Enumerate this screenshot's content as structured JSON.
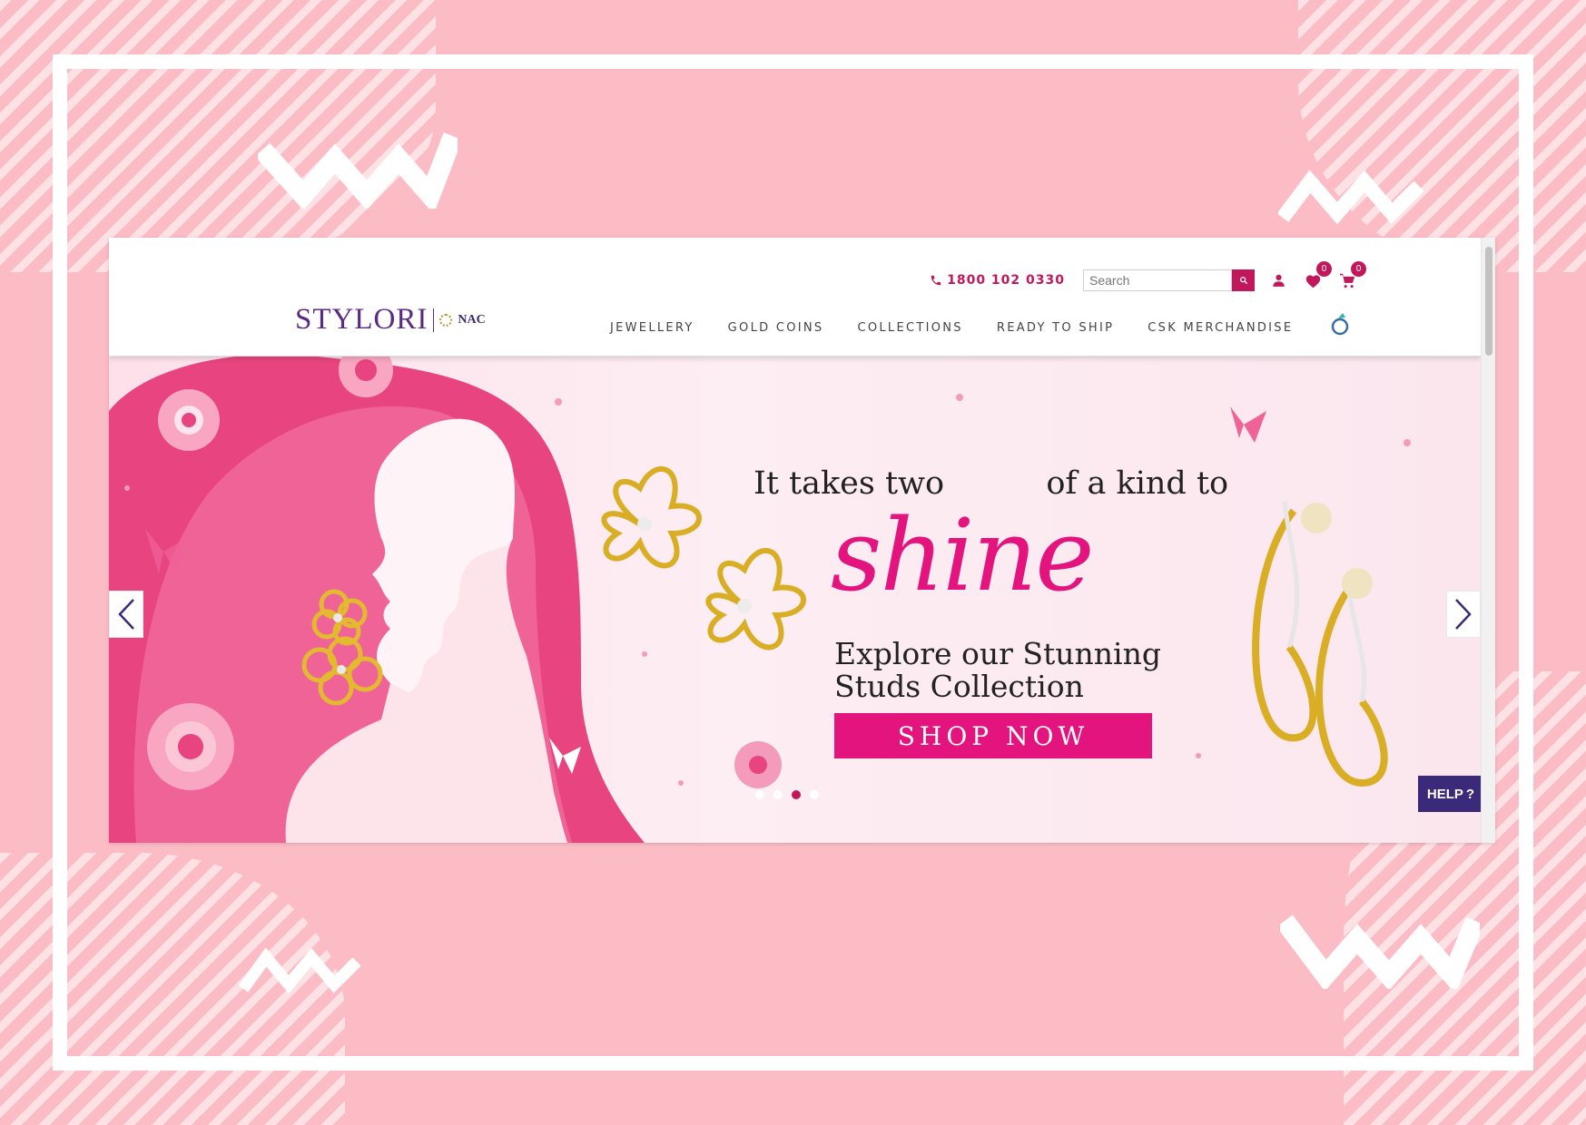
{
  "brand": {
    "logo_main": "STYLORI",
    "logo_sub": "NAC"
  },
  "header": {
    "phone": "1800 102 0330",
    "search_placeholder": "Search",
    "wishlist_count": "0",
    "cart_count": "0"
  },
  "nav": {
    "items": [
      {
        "label": "JEWELLERY"
      },
      {
        "label": "GOLD COINS"
      },
      {
        "label": "COLLECTIONS"
      },
      {
        "label": "READY TO SHIP"
      },
      {
        "label": "CSK MERCHANDISE"
      }
    ]
  },
  "banner": {
    "line1_left": "It takes two",
    "line1_right": "of a kind to",
    "shine": "shine",
    "line2": "Explore our Stunning",
    "line3": "Studs Collection",
    "cta": "SHOP NOW"
  },
  "carousel": {
    "slides": 4,
    "active_index": 2
  },
  "help": {
    "label": "HELP",
    "glyph": "?"
  },
  "colors": {
    "accent": "#c2185b",
    "banner_pink": "#e3147d",
    "brand_purple": "#5b2a83",
    "help_bg": "#3b2a7a",
    "page_bg": "#fcbcc6"
  }
}
